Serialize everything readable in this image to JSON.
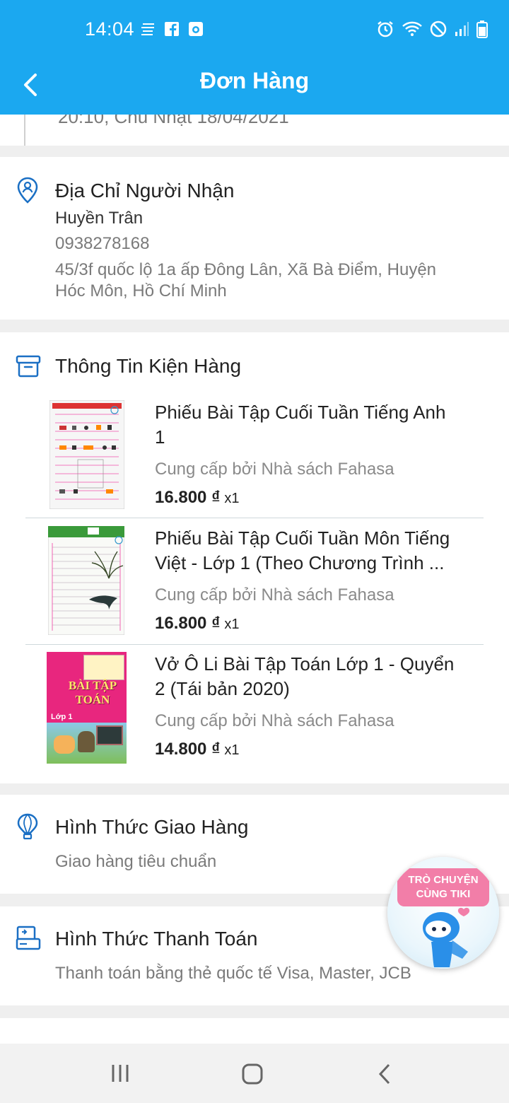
{
  "status_bar": {
    "time": "14:04",
    "left_icons": [
      "notification-lines-icon",
      "facebook-icon",
      "camera-app-icon"
    ],
    "right_icons": [
      "alarm-icon",
      "wifi-icon",
      "do-not-disturb-icon",
      "signal-icon",
      "battery-icon"
    ]
  },
  "header": {
    "title": "Đơn Hàng",
    "back_icon": "chevron-left-icon"
  },
  "order_time": {
    "text": "20:10, Chủ Nhật 18/04/2021"
  },
  "recipient": {
    "title": "Địa Chỉ Người Nhận",
    "name": "Huyền Trân",
    "phone": "0938278168",
    "address_line1": "45/3f quốc lộ 1a ấp Đông Lân, Xã Bà Điểm, Huyện",
    "address_line2": "Hóc Môn, Hồ Chí Minh"
  },
  "package": {
    "title": "Thông Tin Kiện Hàng",
    "items": [
      {
        "name_line1": "Phiếu Bài Tập Cuối Tuần Tiếng Anh",
        "name_line2": "1",
        "seller": "Cung cấp bởi Nhà sách Fahasa",
        "price": "16.800 ₫",
        "qty": "x1"
      },
      {
        "name_line1": "Phiếu Bài Tập Cuối Tuần Môn Tiếng",
        "name_line2": "Việt - Lớp 1 (Theo Chương Trình ...",
        "seller": "Cung cấp bởi Nhà sách Fahasa",
        "price": "16.800 ₫",
        "qty": "x1"
      },
      {
        "name_line1": "Vở Ô Li Bài Tập Toán Lớp 1 - Quyển",
        "name_line2": "2 (Tái bản 2020)",
        "seller": "Cung cấp bởi Nhà sách Fahasa",
        "price": "14.800 ₫",
        "qty": "x1",
        "cover_text": "BÀI TẬP TOÁN",
        "cover_grade": "Lớp 1"
      }
    ]
  },
  "shipping": {
    "title": "Hình Thức Giao Hàng",
    "value": "Giao hàng tiêu chuẩn"
  },
  "payment": {
    "title": "Hình Thức Thanh Toán",
    "value": "Thanh toán bằng thẻ quốc tế Visa, Master, JCB"
  },
  "chat": {
    "line1": "TRÒ CHUYỆN",
    "line2": "CÙNG TIKI"
  },
  "colors": {
    "primary": "#1ba8f0",
    "icon_blue": "#1a6fc4",
    "chat_pink": "#f27ea8"
  }
}
